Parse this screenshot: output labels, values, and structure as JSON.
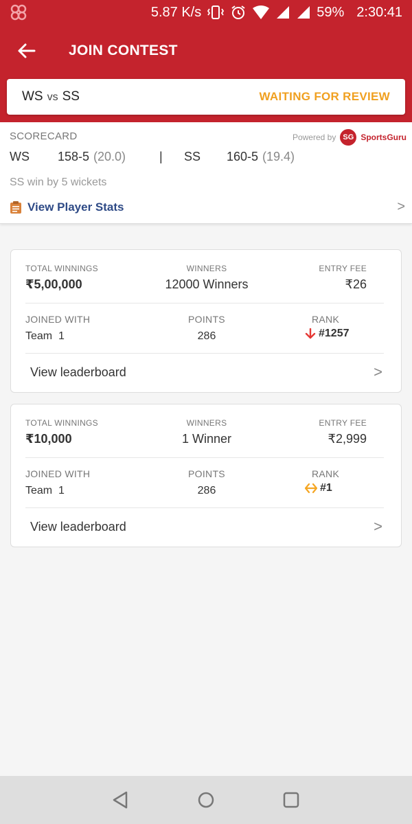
{
  "statusbar": {
    "speed": "5.87 K/s",
    "battery": "59%",
    "time": "2:30:41"
  },
  "appbar": {
    "title": "JOIN CONTEST"
  },
  "match": {
    "team1": "WS",
    "vs": "vs",
    "team2": "SS",
    "status": "WAITING FOR REVIEW"
  },
  "scorecard": {
    "heading": "SCORECARD",
    "powered_by": "Powered by",
    "brand_initials": "SG",
    "brand_name": "SportsGuru",
    "team1": "WS",
    "team1_score": "158-5",
    "team1_overs": "(20.0)",
    "divider": "|",
    "team2": "SS",
    "team2_score": "160-5",
    "team2_overs": "(19.4)",
    "result": "SS win by 5 wickets",
    "player_stats": "View Player Stats"
  },
  "contests": [
    {
      "total_winnings_label": "TOTAL WINNINGS",
      "total_winnings": "₹5,00,000",
      "winners_label": "WINNERS",
      "winners": "12000 Winners",
      "entry_fee_label": "ENTRY FEE",
      "entry_fee": "₹26",
      "joined_label": "JOINED WITH",
      "joined": "Team  1",
      "points_label": "POINTS",
      "points": "286",
      "rank_label": "RANK",
      "rank": "#1257",
      "rank_trend": "down-arrow-icon",
      "leaderboard": "View leaderboard"
    },
    {
      "total_winnings_label": "TOTAL WINNINGS",
      "total_winnings": "₹10,000",
      "winners_label": "WINNERS",
      "winners": "1 Winner",
      "entry_fee_label": "ENTRY FEE",
      "entry_fee": "₹2,999",
      "joined_label": "JOINED WITH",
      "joined": "Team  1",
      "points_label": "POINTS",
      "points": "286",
      "rank_label": "RANK",
      "rank": "#1",
      "rank_trend": "no-change-icon",
      "leaderboard": "View leaderboard"
    }
  ],
  "colors": {
    "brand_red": "#c4232d",
    "waiting_orange": "#f0a020",
    "link_blue": "#2e4a86",
    "rank_down": "#e53935",
    "rank_same": "#f5a623"
  }
}
